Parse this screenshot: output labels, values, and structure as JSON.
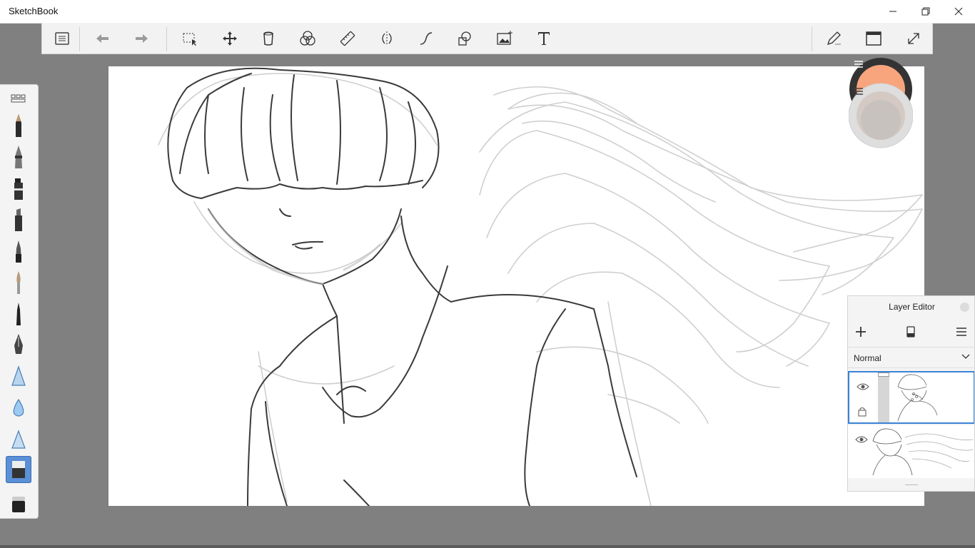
{
  "window": {
    "title": "SketchBook"
  },
  "toolbar": {
    "tools": [
      "lagoon-menu-icon",
      "undo-icon",
      "redo-icon",
      "selection-icon",
      "transform-icon",
      "fill-icon",
      "symmetry-color-icon",
      "ruler-icon",
      "symmetry-icon",
      "curve-icon",
      "shape-icon",
      "add-image-icon",
      "text-icon",
      "pen-mode-icon",
      "window-icon",
      "fullscreen-icon"
    ]
  },
  "brushes": [
    "brush-library-icon",
    "pencil-icon",
    "ink-pen-icon",
    "marker-icon",
    "chisel-marker-icon",
    "felt-pen-icon",
    "paintbrush-icon",
    "fine-liner-icon",
    "fountain-pen-icon",
    "airbrush-icon",
    "water-drop-icon",
    "smudge-icon",
    "eraser-hard-icon",
    "eraser-soft-icon"
  ],
  "colors": {
    "primary": "#F8A57E",
    "secondary": "#C9B5A8",
    "accent": "#3B82D6"
  },
  "layer_editor": {
    "title": "Layer Editor",
    "blend_mode": "Normal"
  }
}
